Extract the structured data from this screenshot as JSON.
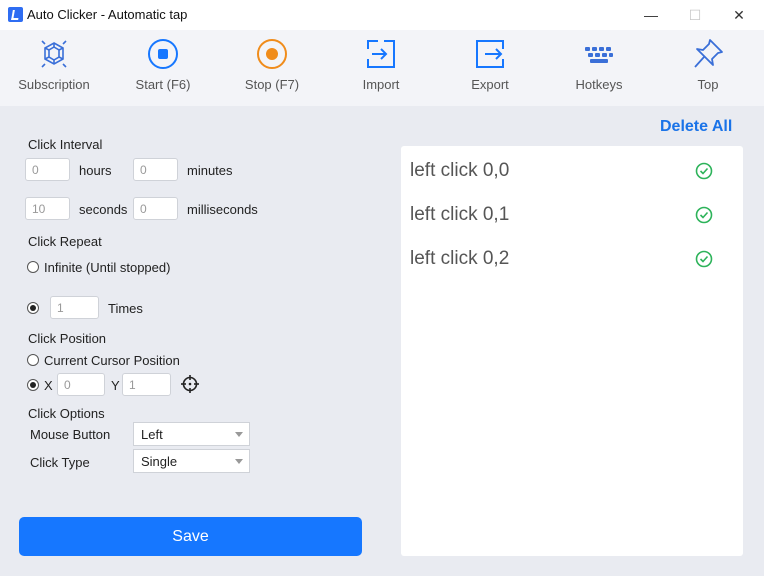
{
  "window": {
    "title": "Auto Clicker - Automatic tap",
    "minimize_glyph": "—",
    "maximize_glyph": "☐",
    "close_glyph": "✕"
  },
  "toolbar": {
    "items": [
      {
        "label": "Subscription",
        "icon": "subscription-gem-icon"
      },
      {
        "label": "Start (F6)",
        "icon": "start-icon"
      },
      {
        "label": "Stop (F7)",
        "icon": "stop-icon"
      },
      {
        "label": "Import",
        "icon": "import-icon"
      },
      {
        "label": "Export",
        "icon": "export-icon"
      },
      {
        "label": "Hotkeys",
        "icon": "keyboard-icon"
      },
      {
        "label": "Top",
        "icon": "pin-icon"
      }
    ]
  },
  "click_interval": {
    "title": "Click Interval",
    "hours": {
      "value": "0",
      "label": "hours"
    },
    "minutes": {
      "value": "0",
      "label": "minutes"
    },
    "seconds": {
      "value": "10",
      "label": "seconds"
    },
    "milliseconds": {
      "value": "0",
      "label": "milliseconds"
    }
  },
  "click_repeat": {
    "title": "Click Repeat",
    "infinite_label": "Infinite (Until stopped)",
    "times_value": "1",
    "times_label": "Times",
    "selected": "times"
  },
  "click_position": {
    "title": "Click Position",
    "current_label": "Current Cursor Position",
    "x_label": "X",
    "x_value": "0",
    "y_label": "Y",
    "y_value": "1",
    "selected": "xy"
  },
  "click_options": {
    "title": "Click Options",
    "mouse_button_label": "Mouse Button",
    "mouse_button_value": "Left",
    "click_type_label": "Click Type",
    "click_type_value": "Single"
  },
  "save_label": "Save",
  "delete_all_label": "Delete All",
  "click_list": [
    {
      "text": "left click 0,0",
      "status": "check-circle-icon"
    },
    {
      "text": "left click 0,1",
      "status": "check-circle-icon"
    },
    {
      "text": "left click 0,2",
      "status": "check-circle-icon"
    }
  ],
  "colors": {
    "accent": "#1677ff",
    "stop": "#f08c1b",
    "success": "#2db35a",
    "toolbar_bg": "#f3f4f8",
    "main_bg": "#e9ebf1"
  }
}
